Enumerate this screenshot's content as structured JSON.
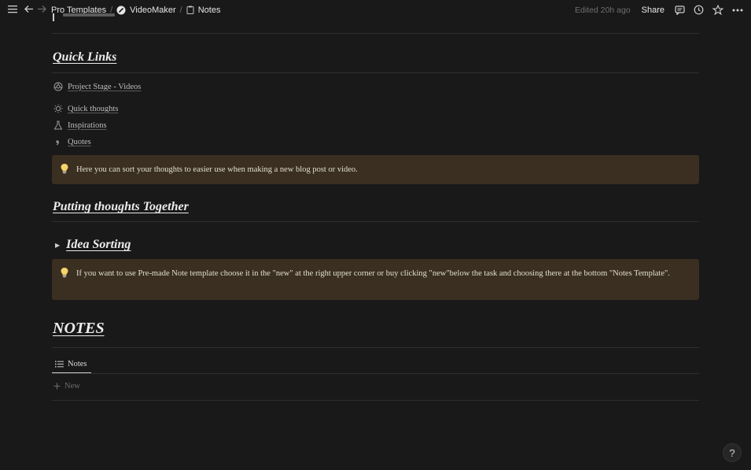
{
  "topbar": {
    "breadcrumbs": [
      {
        "label": "Pro Templates"
      },
      {
        "label": "VideoMaker"
      },
      {
        "label": "Notes"
      }
    ],
    "separator": "/",
    "edited": "Edited 20h ago",
    "share": "Share"
  },
  "sections": {
    "quick_links": {
      "title": "Quick Links",
      "items": [
        {
          "label": "Project Stage - Videos",
          "icon": "dial-icon"
        },
        {
          "label": "Quick thoughts",
          "icon": "lightbulb-icon"
        },
        {
          "label": "Inspirations",
          "icon": "flask-icon"
        },
        {
          "label": "Quotes",
          "icon": "quote-icon"
        }
      ]
    },
    "callout1": "Here you can sort your thoughts to easier use when making a new blog post or video.",
    "putting_together": {
      "title": "Putting thoughts Together"
    },
    "idea_sorting": {
      "title": "Idea Sorting"
    },
    "callout2": "If you want to use Pre-made Note template choose it in the \"new\" at the right upper corner or buy clicking \"new\"below the task and choosing there at the bottom \"Notes Template\".",
    "notes": {
      "title": "NOTES",
      "view_tab": "Notes",
      "new_label": "New"
    }
  },
  "help": {
    "label": "?"
  },
  "colors": {
    "background": "#191919",
    "callout_bg": "#3a2f20",
    "bulb": "#f5d36a"
  }
}
